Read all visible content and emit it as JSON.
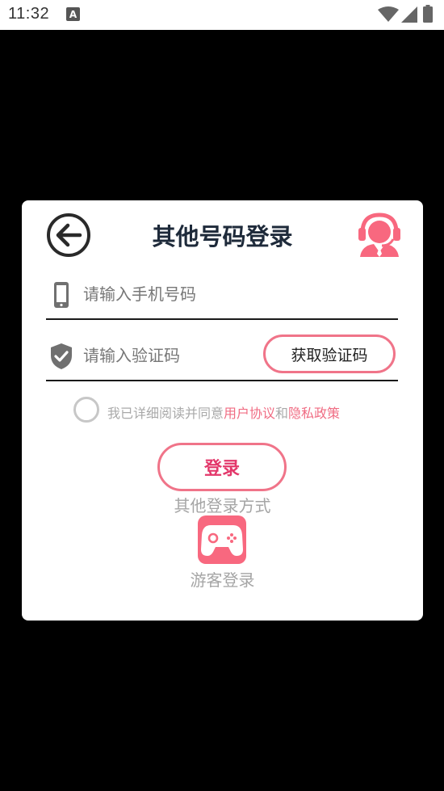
{
  "status_bar": {
    "time": "11:32",
    "app_icon_letter": "A"
  },
  "dialog": {
    "title": "其他号码登录",
    "phone_placeholder": "请输入手机号码",
    "code_placeholder": "请输入验证码",
    "get_code_label": "获取验证码",
    "agreement": {
      "prefix": "我已详细阅读并同意",
      "user_agreement": "用户协议",
      "conjunction": "和",
      "privacy_policy": "隐私政策",
      "checked": false
    },
    "login_label": "登录",
    "other_methods_label": "其他登录方式",
    "guest_label": "游客登录"
  },
  "colors": {
    "accent_pink": "#f07489",
    "login_text": "#e3386b",
    "link_pink": "#f06c83",
    "title": "#1e2a3a"
  }
}
